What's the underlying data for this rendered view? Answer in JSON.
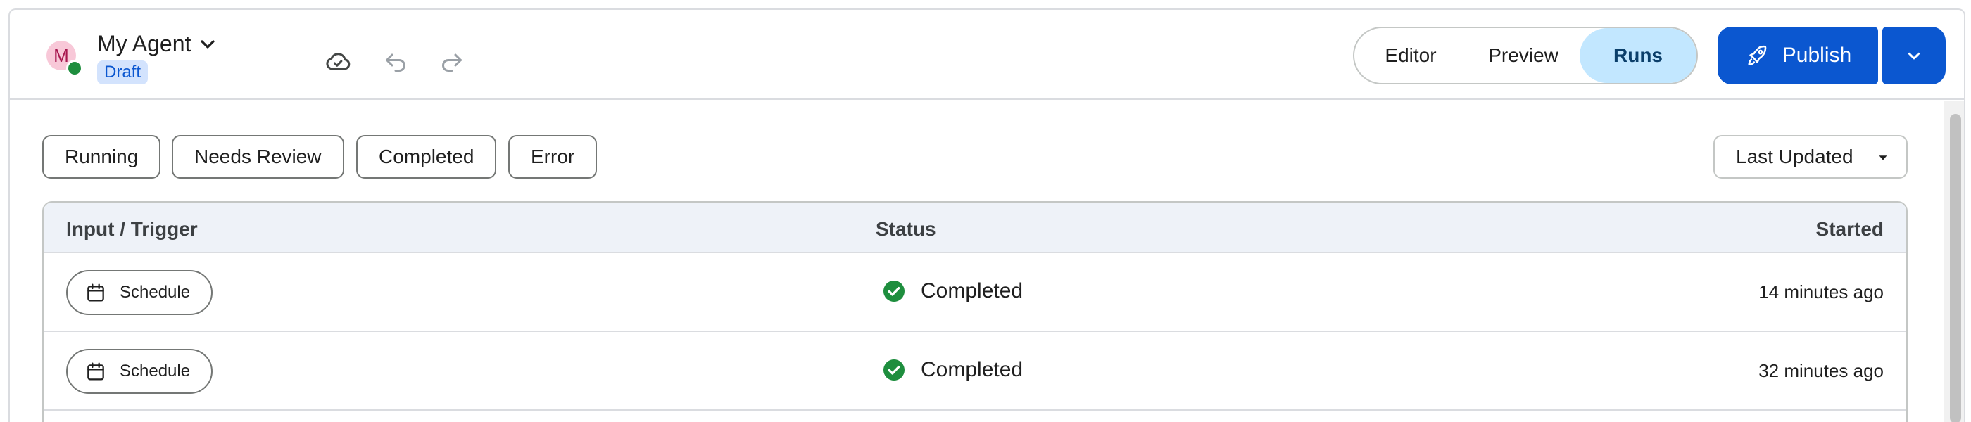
{
  "agent": {
    "avatar_letter": "M",
    "name": "My Agent",
    "status_badge": "Draft"
  },
  "view_toggle": {
    "editor": "Editor",
    "preview": "Preview",
    "runs": "Runs",
    "active": "Runs"
  },
  "publish": {
    "label": "Publish"
  },
  "filters": [
    "Running",
    "Needs Review",
    "Completed",
    "Error"
  ],
  "sort": {
    "selected": "Last Updated"
  },
  "table": {
    "columns": {
      "input": "Input / Trigger",
      "status": "Status",
      "started": "Started"
    },
    "rows": [
      {
        "trigger": "Schedule",
        "status": "Completed",
        "started": "14 minutes ago"
      },
      {
        "trigger": "Schedule",
        "status": "Completed",
        "started": "32 minutes ago"
      }
    ]
  },
  "colors": {
    "accent": "#0b57d0",
    "active_segment": "#c2e7ff",
    "success": "#1e8e3e",
    "draft_badge_bg": "#d3e3fd",
    "header_bg": "#eef2f8"
  },
  "icons": {
    "save_status": "cloud-check-icon",
    "undo": "undo-icon",
    "redo": "redo-icon",
    "publish": "rocket-icon",
    "publish_more": "chevron-down-icon",
    "sort": "dropdown-arrow-icon",
    "trigger": "calendar-icon",
    "status": "check-circle-icon"
  }
}
